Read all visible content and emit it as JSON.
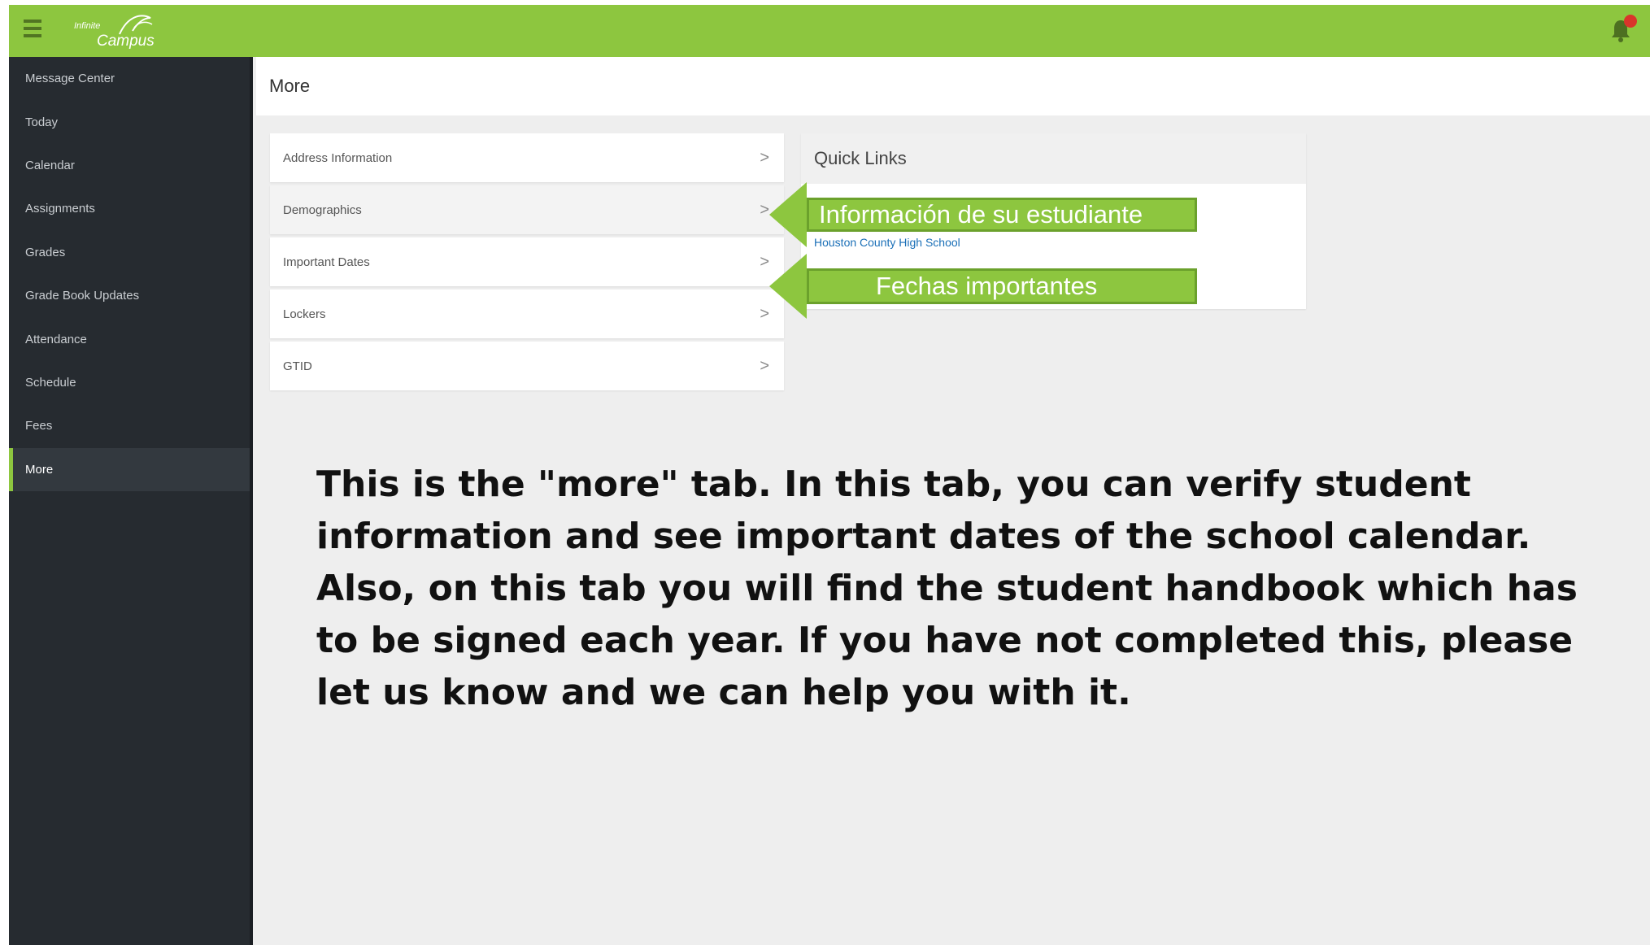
{
  "topbar": {
    "logo_small": "Infinite",
    "logo_big": "Campus"
  },
  "sidebar": {
    "items": [
      {
        "label": "Message Center"
      },
      {
        "label": "Today"
      },
      {
        "label": "Calendar"
      },
      {
        "label": "Assignments"
      },
      {
        "label": "Grades"
      },
      {
        "label": "Grade Book Updates"
      },
      {
        "label": "Attendance"
      },
      {
        "label": "Schedule"
      },
      {
        "label": "Fees"
      },
      {
        "label": "More",
        "active": true
      }
    ]
  },
  "page": {
    "title": "More"
  },
  "more_menu": {
    "items": [
      {
        "label": "Address Information"
      },
      {
        "label": "Demographics"
      },
      {
        "label": "Important Dates"
      },
      {
        "label": "Lockers"
      },
      {
        "label": "GTID"
      }
    ],
    "chevron": ">"
  },
  "quick_links": {
    "title": "Quick Links",
    "links": [
      {
        "label": "Houston County High School"
      }
    ]
  },
  "callouts": {
    "student_info": "Información de su estudiante",
    "important_dates": "Fechas importantes"
  },
  "explanation": "This is the \"more\" tab. In this tab, you can verify student information and see important dates of the school calendar.  Also, on this tab you will find the student handbook which has to be signed each year. If you have not completed this, please let us know and we can help you with it.",
  "colors": {
    "brand_green": "#8dc63f",
    "sidebar_bg": "#262b30",
    "link_blue": "#1a6fb7",
    "notification_red": "#d9352b"
  }
}
